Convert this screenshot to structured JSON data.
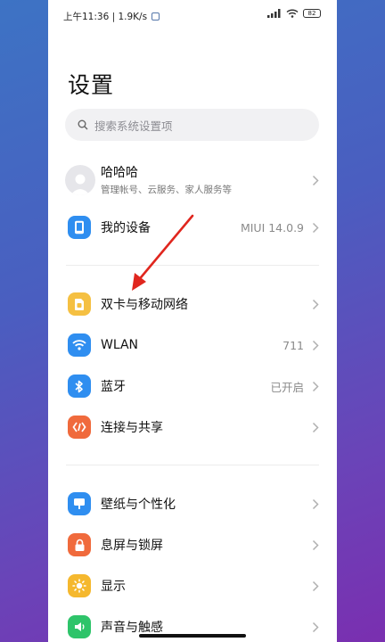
{
  "status_bar": {
    "time_speed": "上午11:36 | 1.9K/s",
    "battery": "82"
  },
  "page": {
    "title": "设置"
  },
  "search": {
    "placeholder": "搜索系统设置项"
  },
  "account": {
    "name": "哈哈哈",
    "subtitle": "管理帐号、云服务、家人服务等"
  },
  "my_device": {
    "label": "我的设备",
    "value": "MIUI 14.0.9"
  },
  "network": [
    {
      "label": "双卡与移动网络",
      "value": "",
      "icon": "sim-card-icon",
      "color": "#f5c042"
    },
    {
      "label": "WLAN",
      "value": "711",
      "icon": "wifi-icon",
      "color": "#2f8ef0"
    },
    {
      "label": "蓝牙",
      "value": "已开启",
      "icon": "bluetooth-icon",
      "color": "#2f8ef0"
    },
    {
      "label": "连接与共享",
      "value": "",
      "icon": "share-icon",
      "color": "#f06a3c"
    }
  ],
  "personal": [
    {
      "label": "壁纸与个性化",
      "icon": "wallpaper-icon",
      "color": "#2f8ef0"
    },
    {
      "label": "息屏与锁屏",
      "icon": "lock-icon",
      "color": "#f06a3c"
    },
    {
      "label": "显示",
      "icon": "brightness-icon",
      "color": "#f5b82e"
    },
    {
      "label": "声音与触感",
      "icon": "sound-icon",
      "color": "#2ec46a"
    }
  ],
  "colors": {
    "annotation_arrow": "#e0261e",
    "device_icon": "#2f8ef0"
  }
}
